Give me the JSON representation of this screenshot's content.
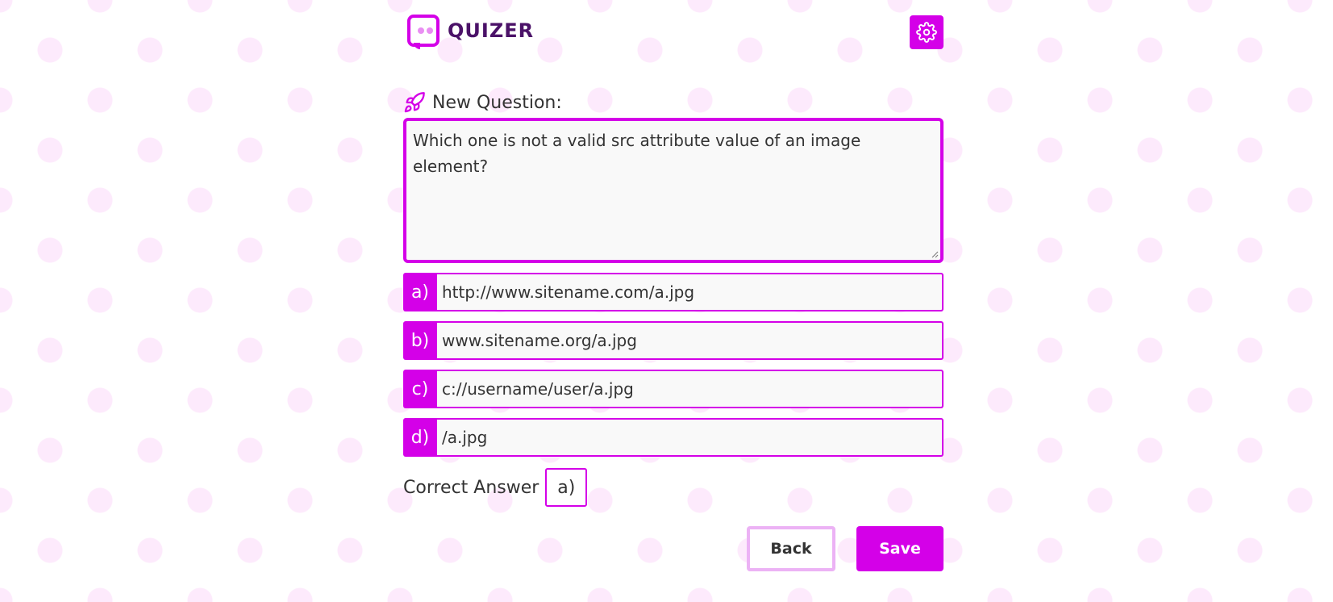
{
  "header": {
    "logo_text": "QUIZER",
    "settings_icon": "gear-icon"
  },
  "question": {
    "label": "New Question:",
    "label_icon": "rocket-icon",
    "text": "Which one is not a valid src attribute value of an image element?"
  },
  "options": [
    {
      "letter": "a)",
      "value": "http://www.sitename.com/a.jpg"
    },
    {
      "letter": "b)",
      "value": "www.sitename.org/a.jpg"
    },
    {
      "letter": "c)",
      "value": "c://username/user/a.jpg"
    },
    {
      "letter": "d)",
      "value": "/a.jpg"
    }
  ],
  "correct_answer": {
    "label": "Correct Answer",
    "selected": "a)"
  },
  "actions": {
    "back_label": "Back",
    "save_label": "Save"
  },
  "colors": {
    "accent": "#d400e8",
    "logo_text": "#4b1268",
    "back_border": "#ecb2f5",
    "background_dots": "#fdeafc"
  }
}
